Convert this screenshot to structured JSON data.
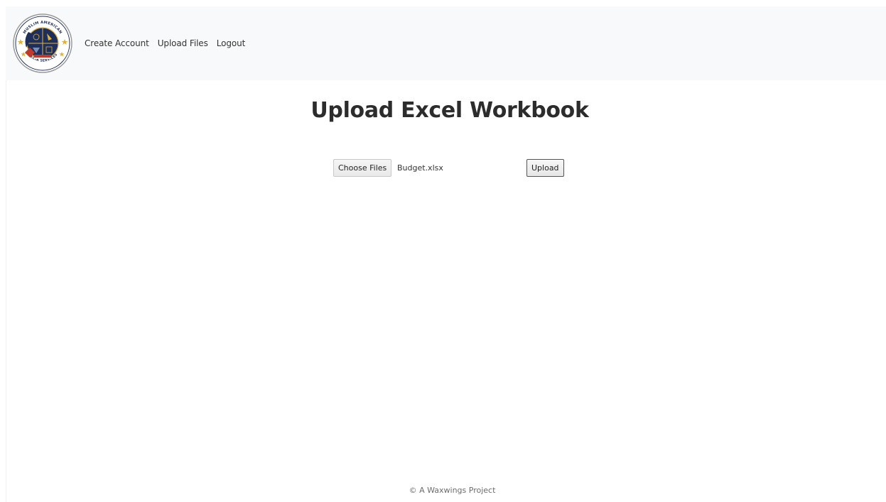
{
  "navbar": {
    "logo_icon": "seal-logo-icon",
    "logo_text_top": "MUSLIM AMERICAN",
    "logo_text_bottom": "MEDIA SERVICES",
    "links": [
      {
        "label": "Create Account"
      },
      {
        "label": "Upload Files"
      },
      {
        "label": "Logout"
      }
    ]
  },
  "main": {
    "title": "Upload Excel Workbook",
    "form": {
      "choose_files_label": "Choose Files",
      "selected_file": "Budget.xlsx",
      "upload_label": "Upload"
    }
  },
  "footer": {
    "text": "© A Waxwings Project"
  },
  "colors": {
    "navbar_bg": "#f8f9fa",
    "seal_navy": "#1f2f5c",
    "seal_gold": "#e0b23a",
    "seal_red": "#c0392b"
  }
}
